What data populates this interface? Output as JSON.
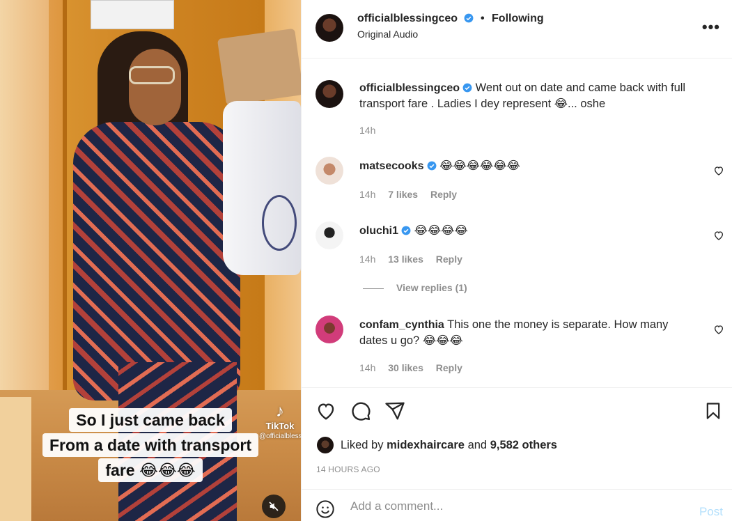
{
  "post": {
    "author": "officialblessingceo",
    "follow_status": "Following",
    "audio": "Original Audio",
    "more_label": "•••",
    "verified_color": "#3897f0"
  },
  "media": {
    "caption_lines": [
      "So I just came back",
      "From a date with transport",
      "fare 😂😂😂"
    ],
    "watermark_brand": "TikTok",
    "watermark_handle": "@officialblessingceo"
  },
  "caption": {
    "username": "officialblessingceo",
    "text": "Went out on date and came back with full transport fare . Ladies I dey represent 😂... oshe",
    "time": "14h"
  },
  "comments": [
    {
      "username": "matsecooks",
      "verified": true,
      "text": "😂😂😂😂😂😂",
      "time": "14h",
      "likes": "7 likes",
      "reply": "Reply"
    },
    {
      "username": "oluchi1",
      "verified": true,
      "text": "😂😂😂😂",
      "time": "14h",
      "likes": "13 likes",
      "reply": "Reply"
    },
    {
      "username": "confam_cynthia",
      "verified": false,
      "text": "This one the money is separate. How many dates u go? 😂😂😂",
      "time": "14h",
      "likes": "30 likes",
      "reply": "Reply"
    }
  ],
  "view_replies": "View replies (1)",
  "likes": {
    "prefix": "Liked by",
    "user": "midexhaircare",
    "conj": "and",
    "others": "9,582 others"
  },
  "timestamp": "14 HOURS AGO",
  "comment_box": {
    "placeholder": "Add a comment...",
    "post_label": "Post"
  }
}
